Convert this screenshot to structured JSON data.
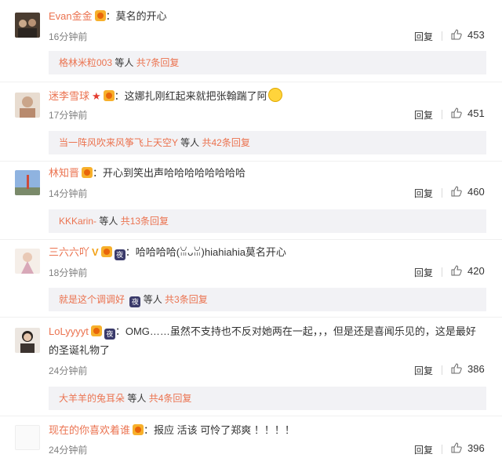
{
  "comments": [
    {
      "username": "Evan金金",
      "text": "：莫名的开心",
      "time": "16分钟前",
      "reply_label": "回复",
      "likes": "453",
      "sub": {
        "name": "格林米粒003",
        "mid": " 等人 ",
        "total": "共7条回复"
      }
    },
    {
      "username": "迷李雪球",
      "text": "：这娜扎刚红起来就把张翰踹了阿",
      "time": "17分钟前",
      "reply_label": "回复",
      "likes": "451",
      "sub": {
        "name": "当一阵风吹来风筝飞上天空Y",
        "mid": " 等人 ",
        "total": "共42条回复"
      }
    },
    {
      "username": "林知晋",
      "text": "：开心到笑出声哈哈哈哈哈哈哈哈",
      "time": "14分钟前",
      "reply_label": "回复",
      "likes": "460",
      "sub": {
        "name": "KKKarin-",
        "mid": " 等人 ",
        "total": "共13条回复"
      }
    },
    {
      "username": "三六六吖",
      "text": "：哈哈哈哈(ꈍᴗꈍ)hiahiahia莫名开心",
      "time": "18分钟前",
      "reply_label": "回复",
      "likes": "420",
      "sub": {
        "name": "就是这个调调好",
        "mid": " 等人 ",
        "total": "共3条回复"
      }
    },
    {
      "username": "LoLyyyyt",
      "text": "：OMG……虽然不支持也不反对她两在一起，，，但是还是喜闻乐见的，这是最好",
      "text2": "的圣诞礼物了",
      "time": "24分钟前",
      "reply_label": "回复",
      "likes": "386",
      "sub": {
        "name": "大羊羊的兔耳朵",
        "mid": " 等人 ",
        "total": "共4条回复"
      }
    },
    {
      "username": "现在的你喜欢着谁",
      "text": "：报应 活该 可怜了郑爽 ！！！！",
      "time": "24分钟前",
      "reply_label": "回复",
      "likes": "396"
    }
  ],
  "badges": {
    "night_label": "夜"
  },
  "colors": {
    "username": "#eb7350",
    "subbox_bg": "#f2f2f5",
    "time": "#808080"
  }
}
